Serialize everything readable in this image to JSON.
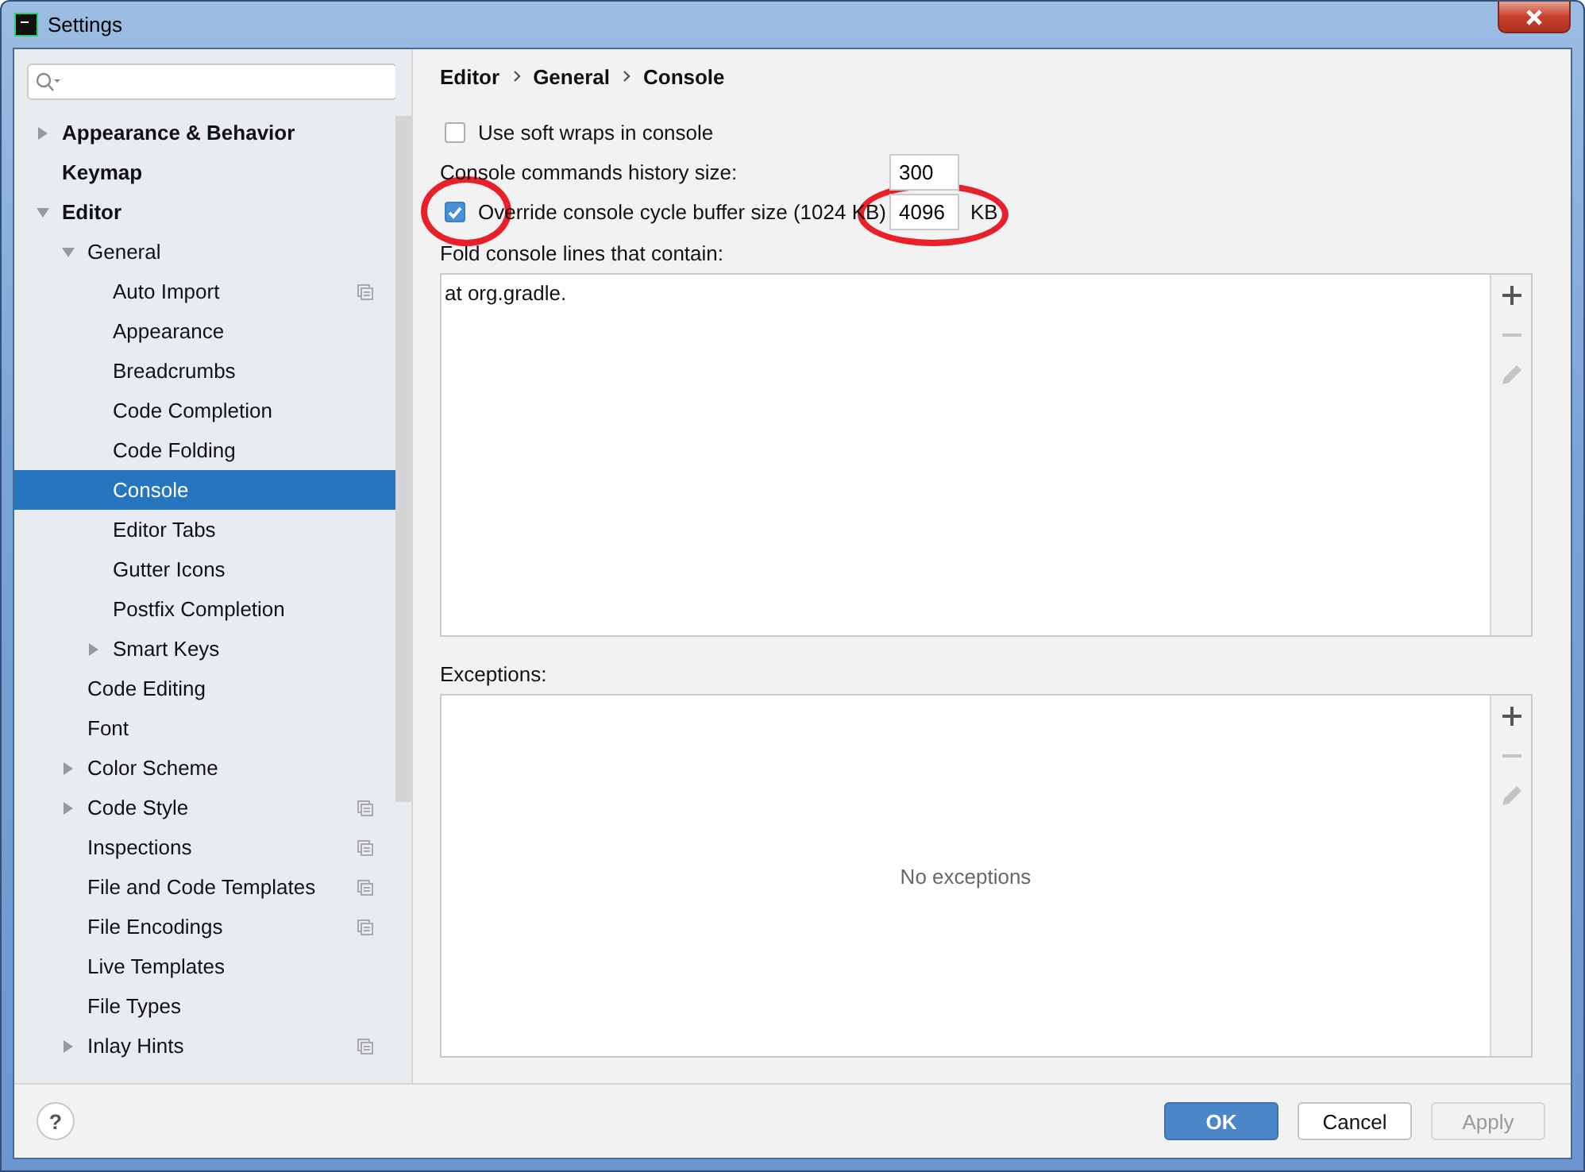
{
  "window": {
    "title": "Settings"
  },
  "tree": [
    {
      "label": "Appearance & Behavior",
      "kind": "branch",
      "expanded": false,
      "scoped": false,
      "selected": false
    },
    {
      "label": "Keymap",
      "kind": "leaf",
      "scoped": false,
      "selected": false
    },
    {
      "label": "Editor",
      "kind": "branch",
      "expanded": true,
      "scoped": false,
      "selected": false,
      "children": [
        {
          "label": "General",
          "kind": "branch",
          "expanded": true,
          "scoped": false,
          "selected": false,
          "children": [
            {
              "label": "Auto Import",
              "kind": "leaf",
              "scoped": true,
              "selected": false
            },
            {
              "label": "Appearance",
              "kind": "leaf",
              "scoped": false,
              "selected": false
            },
            {
              "label": "Breadcrumbs",
              "kind": "leaf",
              "scoped": false,
              "selected": false
            },
            {
              "label": "Code Completion",
              "kind": "leaf",
              "scoped": false,
              "selected": false
            },
            {
              "label": "Code Folding",
              "kind": "leaf",
              "scoped": false,
              "selected": false
            },
            {
              "label": "Console",
              "kind": "leaf",
              "scoped": false,
              "selected": true
            },
            {
              "label": "Editor Tabs",
              "kind": "leaf",
              "scoped": false,
              "selected": false
            },
            {
              "label": "Gutter Icons",
              "kind": "leaf",
              "scoped": false,
              "selected": false
            },
            {
              "label": "Postfix Completion",
              "kind": "leaf",
              "scoped": false,
              "selected": false
            },
            {
              "label": "Smart Keys",
              "kind": "branch",
              "expanded": false,
              "scoped": false,
              "selected": false
            }
          ]
        },
        {
          "label": "Code Editing",
          "kind": "leaf",
          "scoped": false,
          "selected": false
        },
        {
          "label": "Font",
          "kind": "leaf",
          "scoped": false,
          "selected": false
        },
        {
          "label": "Color Scheme",
          "kind": "branch",
          "expanded": false,
          "scoped": false,
          "selected": false
        },
        {
          "label": "Code Style",
          "kind": "branch",
          "expanded": false,
          "scoped": true,
          "selected": false
        },
        {
          "label": "Inspections",
          "kind": "leaf",
          "scoped": true,
          "selected": false
        },
        {
          "label": "File and Code Templates",
          "kind": "leaf",
          "scoped": true,
          "selected": false
        },
        {
          "label": "File Encodings",
          "kind": "leaf",
          "scoped": true,
          "selected": false
        },
        {
          "label": "Live Templates",
          "kind": "leaf",
          "scoped": false,
          "selected": false
        },
        {
          "label": "File Types",
          "kind": "leaf",
          "scoped": false,
          "selected": false
        },
        {
          "label": "Inlay Hints",
          "kind": "branch",
          "expanded": false,
          "scoped": true,
          "selected": false
        }
      ]
    }
  ],
  "breadcrumb": [
    "Editor",
    "General",
    "Console"
  ],
  "options": [
    {
      "kind": "checkbox",
      "label": "Use soft wraps in console",
      "checked": false,
      "highlighted": false
    },
    {
      "kind": "number",
      "label": "Console commands history size:",
      "value": "300",
      "highlighted": false
    },
    {
      "kind": "checkbox_number",
      "label": "Override console cycle buffer size (1024 KB)",
      "checked": true,
      "value": "4096",
      "unit": "KB",
      "highlighted": true
    }
  ],
  "fold_list": {
    "label": "Fold console lines that contain:",
    "items": [
      "at org.gradle."
    ]
  },
  "exceptions": {
    "label": "Exceptions:",
    "empty_text": "No exceptions"
  },
  "help": {
    "label": "?"
  },
  "buttons": [
    {
      "label": "OK",
      "kind": "primary",
      "disabled": false
    },
    {
      "label": "Cancel",
      "kind": "default",
      "disabled": false
    },
    {
      "label": "Apply",
      "kind": "default",
      "disabled": true
    }
  ]
}
